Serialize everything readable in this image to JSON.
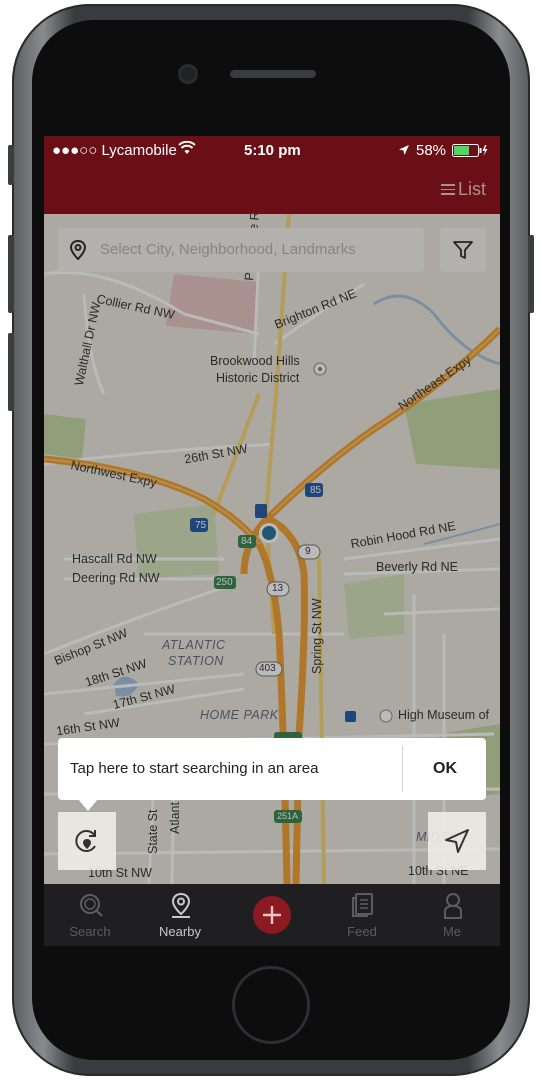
{
  "status_bar": {
    "carrier": "●●●○○ Lycamobile",
    "time": "5:10 pm",
    "battery": "58%"
  },
  "header": {
    "list_label": "List"
  },
  "search": {
    "placeholder": "Select City, Neighborhood, Landmarks"
  },
  "map_labels": {
    "collier": "Collier Rd NW",
    "peachtree": "Peachtree R",
    "brighton": "Brighton Rd NE",
    "walthall": "Walthall Dr NW",
    "brookwood_1": "Brookwood Hills",
    "brookwood_2": "Historic District",
    "northeast": "Northeast Expy",
    "st26": "26th St NW",
    "northwest": "Northwest Expy",
    "i85": "85",
    "i75": "75",
    "r84": "84",
    "r9": "9",
    "robin": "Robin Hood Rd NE",
    "beverly": "Beverly Rd NE",
    "hascall": "Hascall Rd NW",
    "deering": "Deering Rd NW",
    "r250": "250",
    "r13": "13",
    "spring": "Spring St NW",
    "bishop": "Bishop St NW",
    "atlantic_1": "ATLANTIC",
    "atlantic_2": "STATION",
    "st18": "18th St NW",
    "st17": "17th St NW",
    "r403": "403",
    "st16": "16th St NW",
    "home_park": "HOME PARK",
    "high_museum": "High Museum of",
    "state": "State St",
    "atlanta": "Atlant",
    "midtown": "MIDTO",
    "r251a": "251A",
    "st10": "10th St NW",
    "st10b": "10th St NE"
  },
  "tooltip": {
    "text": "Tap here to start searching in an area",
    "ok": "OK"
  },
  "tabs": [
    {
      "label": "Search"
    },
    {
      "label": "Nearby"
    },
    {
      "label": "Feed"
    },
    {
      "label": "Me"
    }
  ],
  "colors": {
    "brand": "#6b0f16",
    "add_button": "#8c1a22",
    "tabbar": "#1f1f21",
    "highway": "#f2a23a",
    "water": "#a7c6e0",
    "park": "#c6dba7",
    "location_dot": "#2f7a9a"
  },
  "icons": {
    "location_pin": "location-pin-icon",
    "filter": "filter-icon",
    "refresh_area": "refresh-area-icon",
    "navigate": "navigate-arrow-icon"
  }
}
